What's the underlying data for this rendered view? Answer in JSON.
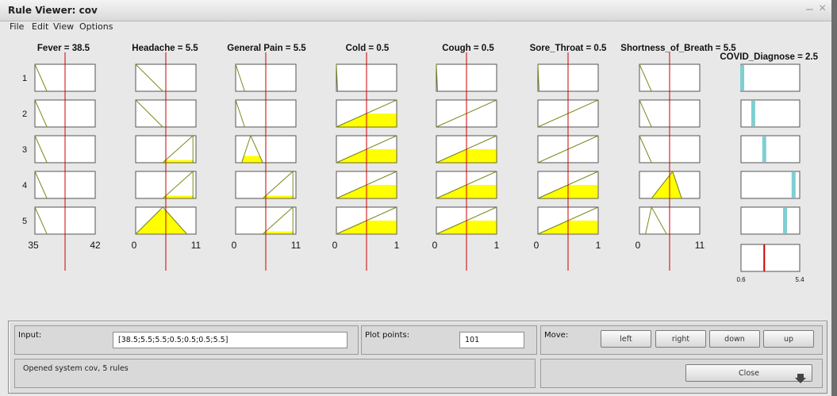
{
  "window": {
    "title": "Rule Viewer: cov",
    "minimize_icon": "minimize-icon",
    "close_icon": "close-icon"
  },
  "menu": [
    "File",
    "Edit",
    "View",
    "Options"
  ],
  "inputs": [
    {
      "header": "Fever = 38.5",
      "range": [
        "35",
        "42"
      ],
      "min": 35,
      "max": 42,
      "value": 38.5
    },
    {
      "header": "Headache = 5.5",
      "range": [
        "0",
        "11"
      ],
      "min": 0,
      "max": 11,
      "value": 5.5
    },
    {
      "header": "General Pain = 5.5",
      "range": [
        "0",
        "11"
      ],
      "min": 0,
      "max": 11,
      "value": 5.5
    },
    {
      "header": "Cold = 0.5",
      "range": [
        "0",
        "1"
      ],
      "min": 0,
      "max": 1,
      "value": 0.5
    },
    {
      "header": "Cough = 0.5",
      "range": [
        "0",
        "1"
      ],
      "min": 0,
      "max": 1,
      "value": 0.5
    },
    {
      "header": "Sore_Throat = 0.5",
      "range": [
        "0",
        "1"
      ],
      "min": 0,
      "max": 1,
      "value": 0.5
    },
    {
      "header": "Shortness_of_Breath = 5.5",
      "range": [
        "0",
        "11"
      ],
      "min": 0,
      "max": 11,
      "value": 5.5
    }
  ],
  "output": {
    "header": "COVID_Diagnose = 2.5",
    "range": [
      "0.6",
      "5.4"
    ],
    "min": 0.6,
    "max": 5.4,
    "value": 2.5,
    "bar_color": "#7ecfd2",
    "line_color": "#cc0000"
  },
  "rule_numbers": [
    "1",
    "2",
    "3",
    "4",
    "5"
  ],
  "rules": [
    {
      "mfs": [
        {
          "shape": [
            [
              0,
              1
            ],
            [
              0.2,
              0
            ]
          ],
          "fill": 0
        },
        {
          "shape": [
            [
              0,
              1
            ],
            [
              0.45,
              0
            ]
          ],
          "fill": 0
        },
        {
          "shape": [
            [
              0,
              1
            ],
            [
              0.15,
              0
            ]
          ],
          "fill": 0
        },
        {
          "shape": [
            [
              0,
              1
            ],
            [
              0.02,
              0
            ]
          ],
          "fill": 0
        },
        {
          "shape": [
            [
              0,
              1
            ],
            [
              0.02,
              0
            ]
          ],
          "fill": 0
        },
        {
          "shape": [
            [
              0,
              1
            ],
            [
              0.02,
              0
            ]
          ],
          "fill": 0
        },
        {
          "shape": [
            [
              0,
              1
            ],
            [
              0.2,
              0
            ]
          ],
          "fill": 0
        }
      ],
      "out": 0.7
    },
    {
      "mfs": [
        {
          "shape": [
            [
              0,
              1
            ],
            [
              0.2,
              0
            ]
          ],
          "fill": 0
        },
        {
          "shape": [
            [
              0,
              1
            ],
            [
              0.45,
              0
            ]
          ],
          "fill": 0
        },
        {
          "shape": [
            [
              0,
              1
            ],
            [
              0.15,
              0
            ]
          ],
          "fill": 0
        },
        {
          "shape": [
            [
              0,
              0
            ],
            [
              1,
              1
            ]
          ],
          "fill": 0.5
        },
        {
          "shape": [
            [
              0,
              0
            ],
            [
              1,
              1
            ]
          ],
          "fill": 0
        },
        {
          "shape": [
            [
              0,
              0
            ],
            [
              1,
              1
            ]
          ],
          "fill": 0
        },
        {
          "shape": [
            [
              0,
              1
            ],
            [
              0.2,
              0
            ]
          ],
          "fill": 0
        }
      ],
      "out": 1.6
    },
    {
      "mfs": [
        {
          "shape": [
            [
              0,
              1
            ],
            [
              0.2,
              0
            ]
          ],
          "fill": 0
        },
        {
          "shape": [
            [
              0.45,
              0
            ],
            [
              0.95,
              1
            ],
            [
              0.95,
              0
            ]
          ],
          "fill": 0.1
        },
        {
          "shape": [
            [
              0.1,
              0
            ],
            [
              0.25,
              1
            ],
            [
              0.45,
              0
            ]
          ],
          "fill": 0.25
        },
        {
          "shape": [
            [
              0,
              0
            ],
            [
              1,
              1
            ]
          ],
          "fill": 0.5
        },
        {
          "shape": [
            [
              0,
              0
            ],
            [
              1,
              1
            ]
          ],
          "fill": 0.5
        },
        {
          "shape": [
            [
              0,
              0
            ],
            [
              1,
              1
            ]
          ],
          "fill": 0
        },
        {
          "shape": [
            [
              0,
              1
            ],
            [
              0.2,
              0
            ]
          ],
          "fill": 0
        }
      ],
      "out": 2.5
    },
    {
      "mfs": [
        {
          "shape": [
            [
              0,
              1
            ],
            [
              0.2,
              0
            ]
          ],
          "fill": 0
        },
        {
          "shape": [
            [
              0.45,
              0
            ],
            [
              0.95,
              1
            ],
            [
              0.95,
              0
            ]
          ],
          "fill": 0.1
        },
        {
          "shape": [
            [
              0.45,
              0
            ],
            [
              0.95,
              1
            ],
            [
              0.95,
              0
            ]
          ],
          "fill": 0.1
        },
        {
          "shape": [
            [
              0,
              0
            ],
            [
              1,
              1
            ]
          ],
          "fill": 0.5
        },
        {
          "shape": [
            [
              0,
              0
            ],
            [
              1,
              1
            ]
          ],
          "fill": 0.5
        },
        {
          "shape": [
            [
              0,
              0
            ],
            [
              1,
              1
            ]
          ],
          "fill": 0.5
        },
        {
          "shape": [
            [
              0.2,
              0
            ],
            [
              0.55,
              1
            ],
            [
              0.7,
              0
            ]
          ],
          "fill": 1
        }
      ],
      "out": 4.9
    },
    {
      "mfs": [
        {
          "shape": [
            [
              0,
              1
            ],
            [
              0.2,
              0
            ]
          ],
          "fill": 0
        },
        {
          "shape": [
            [
              0,
              0
            ],
            [
              0.45,
              1
            ],
            [
              0.85,
              0
            ]
          ],
          "fill": 0.9
        },
        {
          "shape": [
            [
              0.45,
              0
            ],
            [
              0.95,
              1
            ],
            [
              0.95,
              0
            ]
          ],
          "fill": 0.1
        },
        {
          "shape": [
            [
              0,
              0
            ],
            [
              1,
              1
            ]
          ],
          "fill": 0.5
        },
        {
          "shape": [
            [
              0,
              0
            ],
            [
              1,
              1
            ]
          ],
          "fill": 0.5
        },
        {
          "shape": [
            [
              0,
              0
            ],
            [
              1,
              1
            ]
          ],
          "fill": 0.5
        },
        {
          "shape": [
            [
              0.1,
              0
            ],
            [
              0.2,
              1
            ],
            [
              0.45,
              0
            ]
          ],
          "fill": 0
        }
      ],
      "out": 4.2
    }
  ],
  "colors": {
    "mf_line": "#7a8a1e",
    "fill": "#ffff00",
    "fill_edge": "#5a5a00",
    "input_line": "#cc0000"
  },
  "input_panel": {
    "label": "Input:",
    "value": "[38.5;5.5;5.5;0.5;0.5;0.5;5.5]"
  },
  "plot_points": {
    "label": "Plot points:",
    "value": "101"
  },
  "move": {
    "label": "Move:",
    "buttons": [
      "left",
      "right",
      "down",
      "up"
    ]
  },
  "status": "Opened system cov, 5 rules",
  "close": {
    "label": "Close",
    "icon": "resize-grip-icon"
  }
}
